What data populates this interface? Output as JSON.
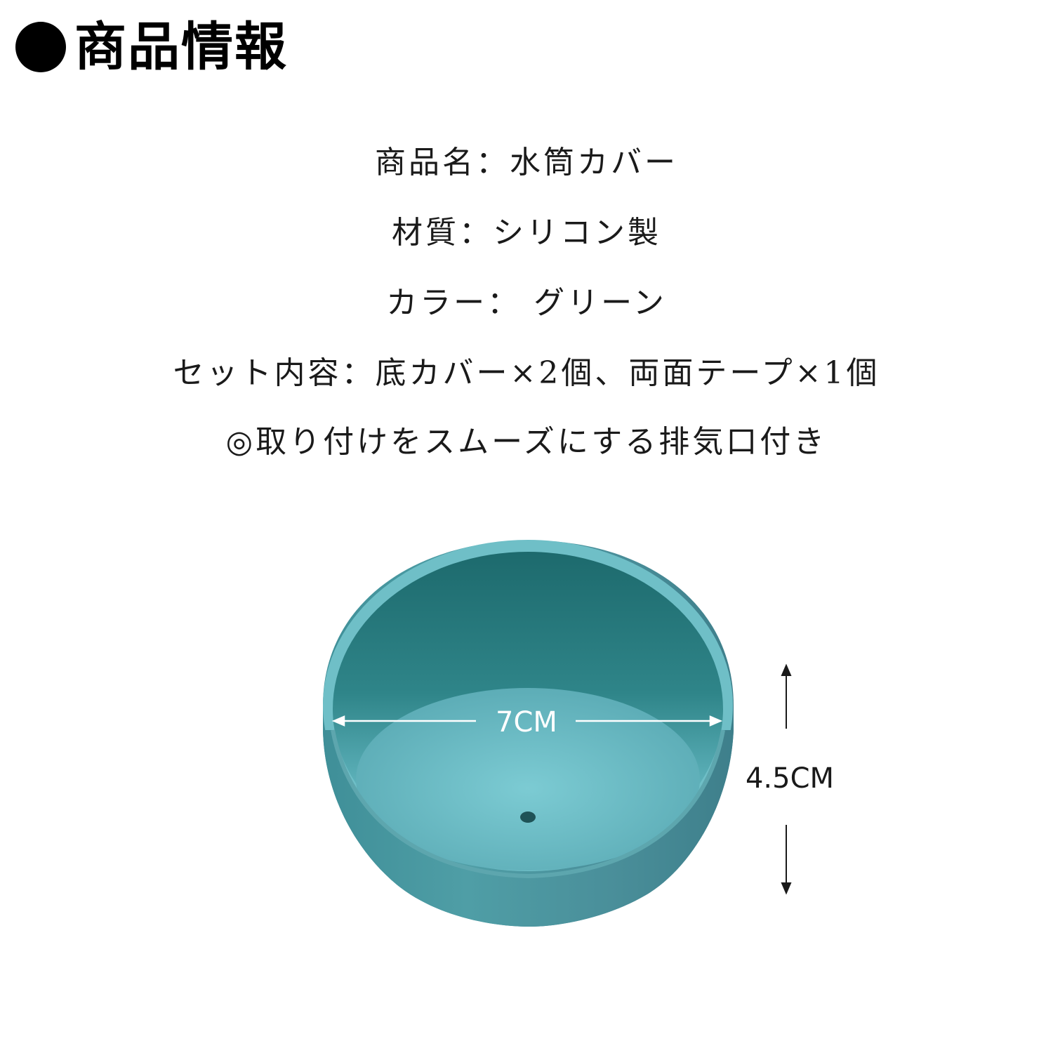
{
  "header": {
    "title": "商品情報"
  },
  "info": {
    "name_line": "商品名：水筒カバー",
    "material_line": "材質：シリコン製",
    "color_line": "カラー： グリーン",
    "set_line": "セット内容：底カバー×2個、両面テープ×1個",
    "feature_line": "◎取り付けをスムーズにする排気口付き"
  },
  "dimensions": {
    "width_label": "7CM",
    "height_label": "4.5CM"
  },
  "colors": {
    "product_teal": "#4b9aa2",
    "rim_light": "#7ec8cf",
    "inner_dark": "#1f6f72",
    "inner_floor": "#6bbfc8"
  }
}
